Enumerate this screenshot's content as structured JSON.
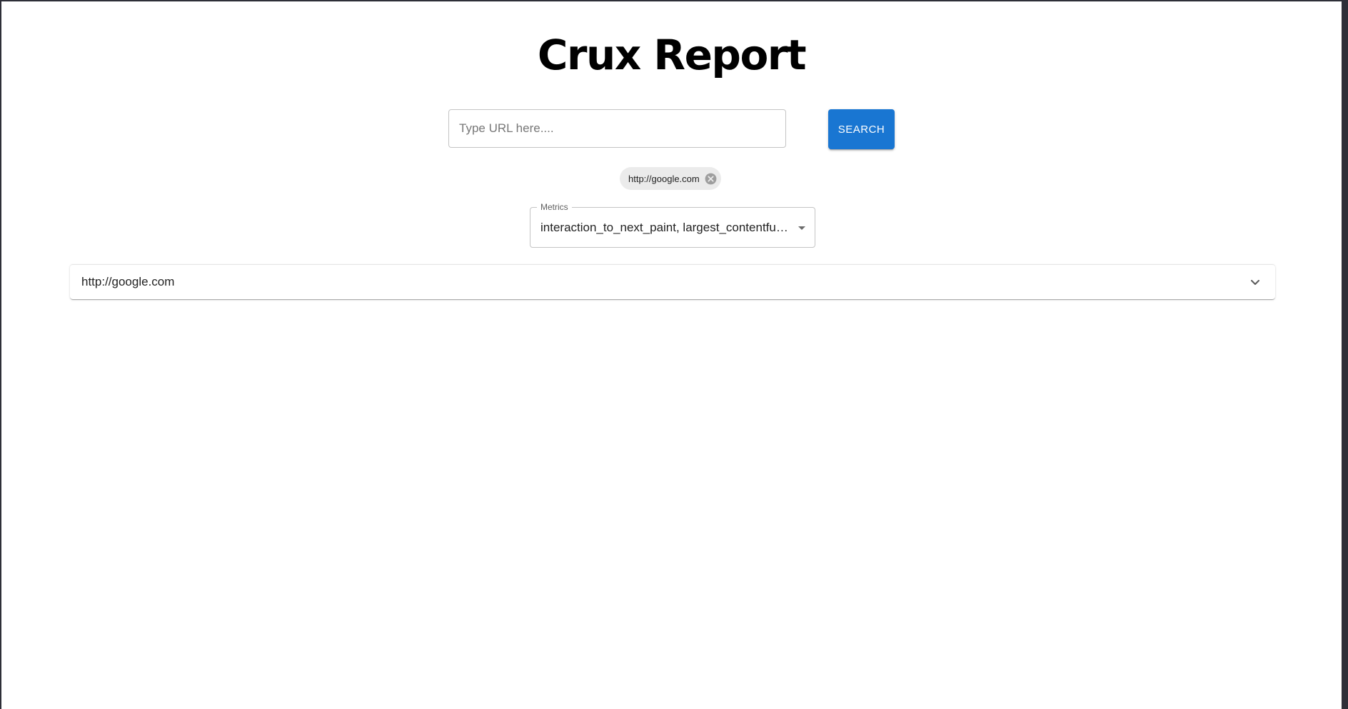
{
  "page": {
    "title": "Crux Report"
  },
  "search": {
    "placeholder": "Type URL here....",
    "value": "",
    "button_label": "SEARCH"
  },
  "url_chips": [
    {
      "label": "http://google.com",
      "delete_icon": "cancel-circle-icon"
    }
  ],
  "metrics_select": {
    "label": "Metrics",
    "value": "interaction_to_next_paint, largest_contentful_...",
    "icon": "arrow-drop-down-icon"
  },
  "results": [
    {
      "title": "http://google.com",
      "expanded": false,
      "icon": "expand-more-icon"
    }
  ],
  "colors": {
    "accent": "#1976d2",
    "chip_background": "#ebebeb",
    "border": "#c4c4c4"
  }
}
